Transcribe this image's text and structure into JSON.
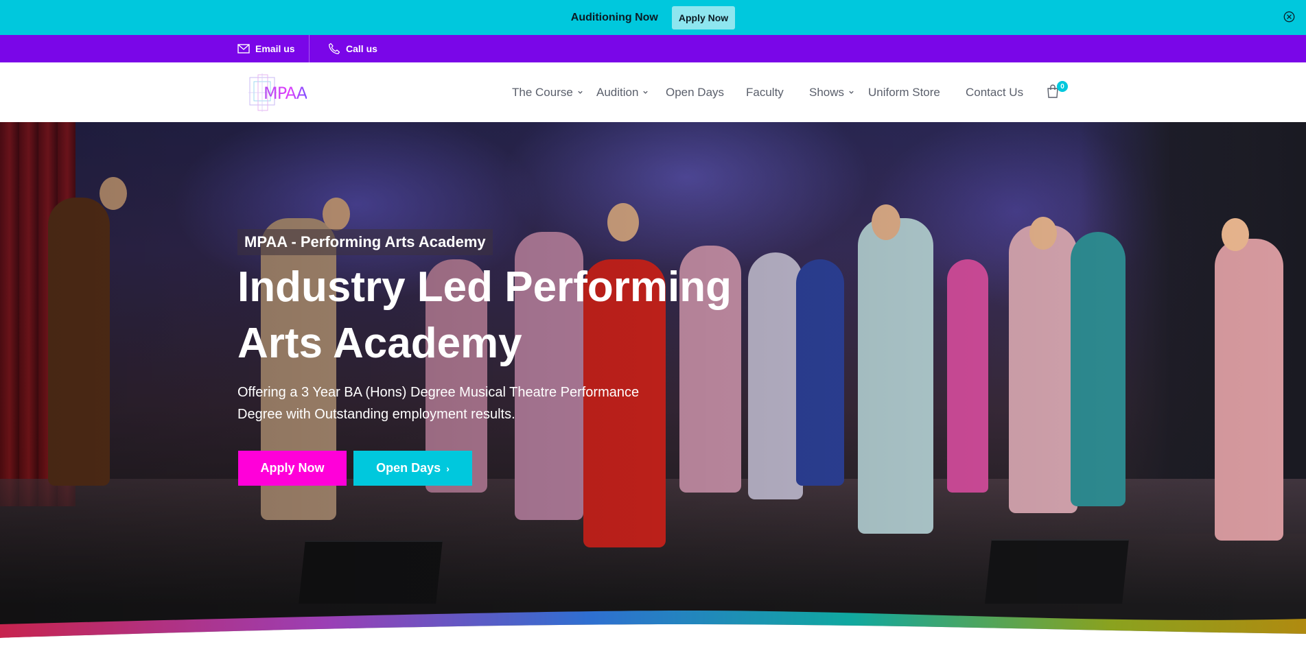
{
  "announcement": {
    "text": "Auditioning Now",
    "button_label": "Apply Now"
  },
  "contact": {
    "email_label": "Email us",
    "call_label": "Call us"
  },
  "header": {
    "logo_text": "MPAA",
    "nav": [
      {
        "label": "The Course",
        "has_dropdown": true
      },
      {
        "label": "Audition",
        "has_dropdown": true
      },
      {
        "label": "Open Days",
        "has_dropdown": false
      },
      {
        "label": "Faculty",
        "has_dropdown": false
      },
      {
        "label": "Shows",
        "has_dropdown": true
      },
      {
        "label": "Uniform Store",
        "has_dropdown": false
      },
      {
        "label": "Contact Us",
        "has_dropdown": false
      }
    ],
    "cart_count": "0"
  },
  "hero": {
    "tagline": "MPAA - Performing Arts Academy",
    "title": "Industry Led Performing Arts Academy",
    "subtitle": "Offering a 3 Year BA (Hons) Degree Musical Theatre Performance Degree with Outstanding employment results.",
    "primary_button": "Apply Now",
    "secondary_button": "Open Days"
  },
  "colors": {
    "announcement_bg": "#00c8dd",
    "contact_bar_bg": "#7a06e8",
    "primary_button": "#ff00d9",
    "secondary_button": "#00c8dd"
  },
  "icons": [
    "close-icon",
    "mail-icon",
    "phone-icon",
    "chevron-down-icon",
    "cart-icon",
    "chevron-right-icon"
  ]
}
